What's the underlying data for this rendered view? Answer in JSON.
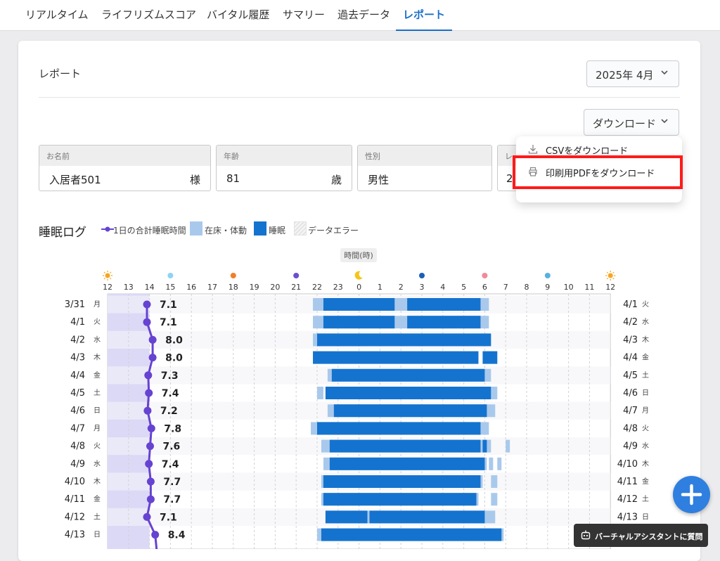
{
  "tabs": [
    {
      "label": "リアルタイム",
      "active": false
    },
    {
      "label": "ライフリズムスコア",
      "active": false
    },
    {
      "label": "バイタル履歴",
      "active": false
    },
    {
      "label": "サマリー",
      "active": false
    },
    {
      "label": "過去データ",
      "active": false
    },
    {
      "label": "レポート",
      "active": true
    }
  ],
  "page_title": "レポート",
  "month_select": {
    "value": "2025年 4月"
  },
  "download_button": {
    "label": "ダウンロード"
  },
  "download_menu": {
    "items": [
      {
        "label": "CSVをダウンロード",
        "icon": "download-icon"
      },
      {
        "label": "印刷用PDFをダウンロード",
        "icon": "printer-icon"
      }
    ]
  },
  "info": {
    "name": {
      "header": "お名前",
      "value": "入居者501",
      "unit": "様"
    },
    "age": {
      "header": "年齢",
      "value": "81",
      "unit": "歳"
    },
    "gender": {
      "header": "性別",
      "value": "男性"
    },
    "other": {
      "header": "レ",
      "value": "2"
    }
  },
  "legend": {
    "title": "睡眠ログ",
    "total_sleep": "1日の合計睡眠時間",
    "in_bed": "在床・体動",
    "sleep": "睡眠",
    "data_error": "データエラー"
  },
  "colors": {
    "accent": "#1a6fc9",
    "in_bed": "#a9c9ec",
    "sleep": "#1473cf",
    "total_line": "#6643d1",
    "band": "#dcd9f7",
    "highlight": "#ff1a1a"
  },
  "assistant": {
    "label": "バーチャルアシスタントに質問"
  },
  "chart_data": {
    "type": "timeline",
    "time_axis_label": "時間(時)",
    "hour_ticks": [
      "12",
      "13",
      "14",
      "15",
      "16",
      "17",
      "18",
      "19",
      "20",
      "21",
      "22",
      "23",
      "0",
      "1",
      "2",
      "3",
      "4",
      "5",
      "6",
      "7",
      "8",
      "9",
      "10",
      "11",
      "12"
    ],
    "tick_icons": [
      {
        "hour": "12",
        "icon": "sun-icon",
        "color": "#f5a623"
      },
      {
        "hour": "15",
        "icon": "dot-icon",
        "color": "#8fd3f4"
      },
      {
        "hour": "18",
        "icon": "dot-icon",
        "color": "#f07f2a"
      },
      {
        "hour": "21",
        "icon": "dot-icon",
        "color": "#6a4fd0"
      },
      {
        "hour": "0",
        "icon": "moon-icon",
        "color": "#f5c518"
      },
      {
        "hour": "3",
        "icon": "dot-icon",
        "color": "#1c5fb8"
      },
      {
        "hour": "6",
        "icon": "dot-icon",
        "color": "#f08a9a"
      },
      {
        "hour": "9",
        "icon": "dot-icon",
        "color": "#5ab0e0"
      },
      {
        "hour": "12",
        "icon": "sun-icon",
        "color": "#f5a623"
      }
    ],
    "rows": [
      {
        "left_date": "3/31",
        "left_day": "月",
        "right_date": "4/1",
        "right_day": "火",
        "total": "7.1",
        "in_bed": [
          [
            21.8,
            30.2
          ]
        ],
        "sleep": [
          [
            22.3,
            25.7
          ],
          [
            26.3,
            29.8
          ]
        ]
      },
      {
        "left_date": "4/1",
        "left_day": "火",
        "right_date": "4/2",
        "right_day": "水",
        "total": "7.1",
        "in_bed": [
          [
            21.8,
            30.2
          ]
        ],
        "sleep": [
          [
            22.3,
            25.7
          ],
          [
            26.3,
            29.8
          ]
        ]
      },
      {
        "left_date": "4/2",
        "left_day": "水",
        "right_date": "4/3",
        "right_day": "木",
        "total": "8.0",
        "in_bed": [
          [
            21.8,
            30.2
          ]
        ],
        "sleep": [
          [
            22.0,
            30.3
          ]
        ]
      },
      {
        "left_date": "4/3",
        "left_day": "木",
        "right_date": "4/4",
        "right_day": "金",
        "total": "8.0",
        "in_bed": [],
        "sleep": [
          [
            21.8,
            29.7
          ],
          [
            29.9,
            30.6
          ]
        ]
      },
      {
        "left_date": "4/4",
        "left_day": "金",
        "right_date": "4/5",
        "right_day": "土",
        "total": "7.3",
        "in_bed": [
          [
            22.5,
            30.3
          ]
        ],
        "sleep": [
          [
            22.7,
            30.0
          ]
        ]
      },
      {
        "left_date": "4/5",
        "left_day": "土",
        "right_date": "4/6",
        "right_day": "日",
        "total": "7.4",
        "in_bed": [
          [
            22.0,
            22.3
          ],
          [
            30.3,
            30.6
          ]
        ],
        "sleep": [
          [
            22.4,
            30.3
          ]
        ]
      },
      {
        "left_date": "4/6",
        "left_day": "日",
        "right_date": "4/7",
        "right_day": "月",
        "total": "7.2",
        "in_bed": [
          [
            22.5,
            30.5
          ]
        ],
        "sleep": [
          [
            22.8,
            30.1
          ]
        ]
      },
      {
        "left_date": "4/7",
        "left_day": "月",
        "right_date": "4/8",
        "right_day": "火",
        "total": "7.8",
        "in_bed": [
          [
            21.7,
            30.2
          ]
        ],
        "sleep": [
          [
            22.0,
            29.8
          ]
        ]
      },
      {
        "left_date": "4/8",
        "left_day": "火",
        "right_date": "4/9",
        "right_day": "水",
        "total": "7.6",
        "in_bed": [
          [
            22.2,
            30.3
          ],
          [
            31.0,
            31.2
          ]
        ],
        "sleep": [
          [
            22.6,
            29.8
          ],
          [
            29.9,
            30.1
          ]
        ]
      },
      {
        "left_date": "4/9",
        "left_day": "水",
        "right_date": "4/10",
        "right_day": "木",
        "total": "7.4",
        "in_bed": [
          [
            22.3,
            30.1
          ],
          [
            30.2,
            30.4
          ],
          [
            30.6,
            30.8
          ]
        ],
        "sleep": [
          [
            22.6,
            30.0
          ]
        ]
      },
      {
        "left_date": "4/10",
        "left_day": "木",
        "right_date": "4/11",
        "right_day": "金",
        "total": "7.7",
        "in_bed": [
          [
            22.2,
            29.9
          ],
          [
            30.3,
            30.6
          ]
        ],
        "sleep": [
          [
            22.3,
            29.8
          ]
        ]
      },
      {
        "left_date": "4/11",
        "left_day": "金",
        "right_date": "4/12",
        "right_day": "土",
        "total": "7.7",
        "in_bed": [
          [
            22.2,
            29.7
          ],
          [
            30.3,
            30.6
          ]
        ],
        "sleep": [
          [
            22.3,
            29.6
          ]
        ]
      },
      {
        "left_date": "4/12",
        "left_day": "土",
        "right_date": "4/13",
        "right_day": "日",
        "total": "7.1",
        "in_bed": [
          [
            22.4,
            30.5
          ]
        ],
        "sleep": [
          [
            22.4,
            24.4
          ],
          [
            24.5,
            30.0
          ]
        ]
      },
      {
        "left_date": "4/13",
        "left_day": "日",
        "right_date": "",
        "right_day": "",
        "total": "8.4",
        "in_bed": [
          [
            22.0,
            30.9
          ]
        ],
        "sleep": [
          [
            22.2,
            30.8
          ]
        ]
      }
    ]
  }
}
